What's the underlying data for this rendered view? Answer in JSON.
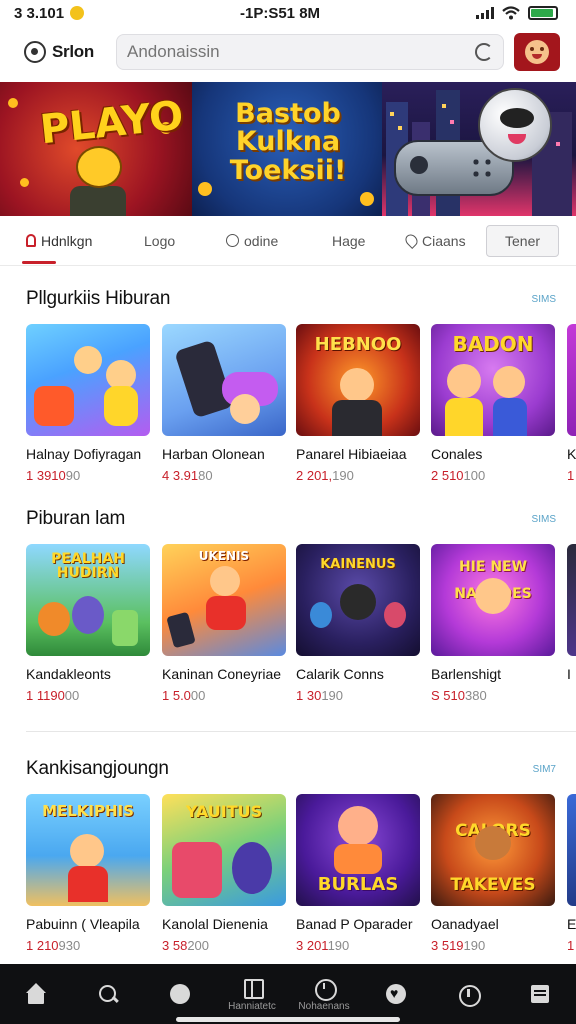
{
  "status_bar": {
    "time_left": "3 3.101",
    "time_center": "-1P:S51 8M"
  },
  "header": {
    "brand": "Srlon",
    "search_placeholder": "Andonaissin"
  },
  "banners": [
    {
      "title": "PLAYO"
    },
    {
      "title": "Bastob Kulkna Toeksii!"
    },
    {
      "title": ""
    }
  ],
  "tabs": [
    {
      "label": "Hdnlkgn"
    },
    {
      "label": "Logo"
    },
    {
      "label": "odine"
    },
    {
      "label": "Hage"
    },
    {
      "label": "Ciaans"
    },
    {
      "label": "Tener"
    }
  ],
  "sections": [
    {
      "title": "Pllgurkiis Hiburan",
      "more": "SIMS",
      "cards": [
        {
          "title": "Halnay Dofiyragan",
          "count_red": "1 3910",
          "count_gray": "90",
          "art_text": ""
        },
        {
          "title": "Harban Olonean",
          "count_red": "4 3.91",
          "count_gray": "80",
          "art_text": ""
        },
        {
          "title": "Panarel Hibiaeiaa",
          "count_red": "2 201,",
          "count_gray": "190",
          "art_text": "HEBNOO"
        },
        {
          "title": "Conales",
          "count_red": "2 510",
          "count_gray": "100",
          "art_text": "BADON"
        },
        {
          "title": "K",
          "count_red": "1",
          "count_gray": "",
          "art_text": ""
        }
      ]
    },
    {
      "title": "Piburan lam",
      "more": "SIMS",
      "cards": [
        {
          "title": "Kandakleonts",
          "count_red": "1 1190",
          "count_gray": "00",
          "art_text": "PEALHAH HUDIRN"
        },
        {
          "title": "Kaninan Coneyriae",
          "count_red": "1 5.0",
          "count_gray": "00",
          "art_text": "UKENIS"
        },
        {
          "title": "Calarik Conns",
          "count_red": "1 30",
          "count_gray": "190",
          "art_text": "KAINENUS"
        },
        {
          "title": "Barlenshigt",
          "count_red": "S 510",
          "count_gray": "380",
          "art_text": "HIE NEW NANDOES"
        },
        {
          "title": "I",
          "count_red": "",
          "count_gray": "",
          "art_text": ""
        }
      ]
    },
    {
      "title": "Kankisangjoungn",
      "more": "SIM7",
      "cards": [
        {
          "title": "Pabuinn ( Vleapila",
          "count_red": "1 210",
          "count_gray": "930",
          "art_text": "MELKIPHIS"
        },
        {
          "title": "Kanolal Dienenia",
          "count_red": "3 58",
          "count_gray": "200",
          "art_text": "YAUITUS"
        },
        {
          "title": "Banad P Oparader",
          "count_red": "3 201",
          "count_gray": "190",
          "art_text": "BURLAS"
        },
        {
          "title": "Oanadyael",
          "count_red": "3 519",
          "count_gray": "190",
          "art_text": "CALORS TAKEVES"
        },
        {
          "title": "E",
          "count_red": "1",
          "count_gray": "",
          "art_text": ""
        }
      ]
    }
  ],
  "bottom_nav": [
    {
      "icon": "home-icon",
      "label": ""
    },
    {
      "icon": "search-icon",
      "label": ""
    },
    {
      "icon": "chat-icon",
      "label": ""
    },
    {
      "icon": "grid-icon",
      "label": "Hanniatetc"
    },
    {
      "icon": "clock-icon",
      "label": "Nohaenans"
    },
    {
      "icon": "heart-icon",
      "label": ""
    },
    {
      "icon": "info-icon",
      "label": ""
    },
    {
      "icon": "menu-icon",
      "label": ""
    }
  ],
  "colors": {
    "accent": "#c8202a",
    "avatar_bg": "#a3161c",
    "nav_bg": "#0f1012",
    "more_link": "#5aa3c8"
  }
}
